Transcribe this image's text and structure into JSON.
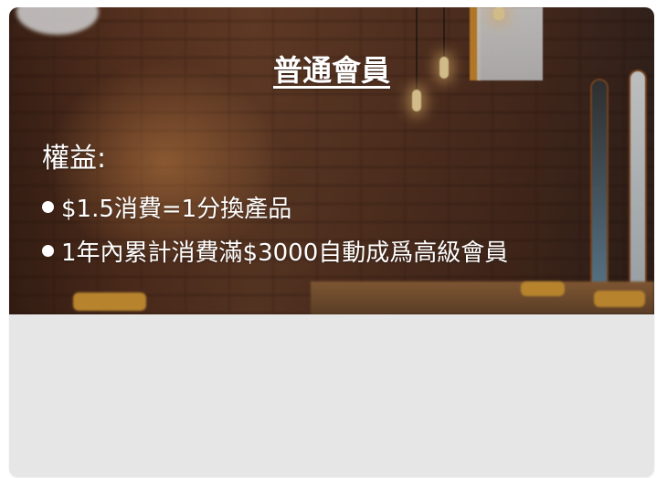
{
  "card": {
    "title": "普通會員",
    "section_label": "權益:",
    "benefits": [
      {
        "text": "$1.5消費=1分換產品"
      },
      {
        "text": "1年內累計消費滿$3000自動成爲高級會員"
      }
    ]
  },
  "colors": {
    "text": "#ffffff",
    "lower_panel": "#e6e6e6"
  }
}
